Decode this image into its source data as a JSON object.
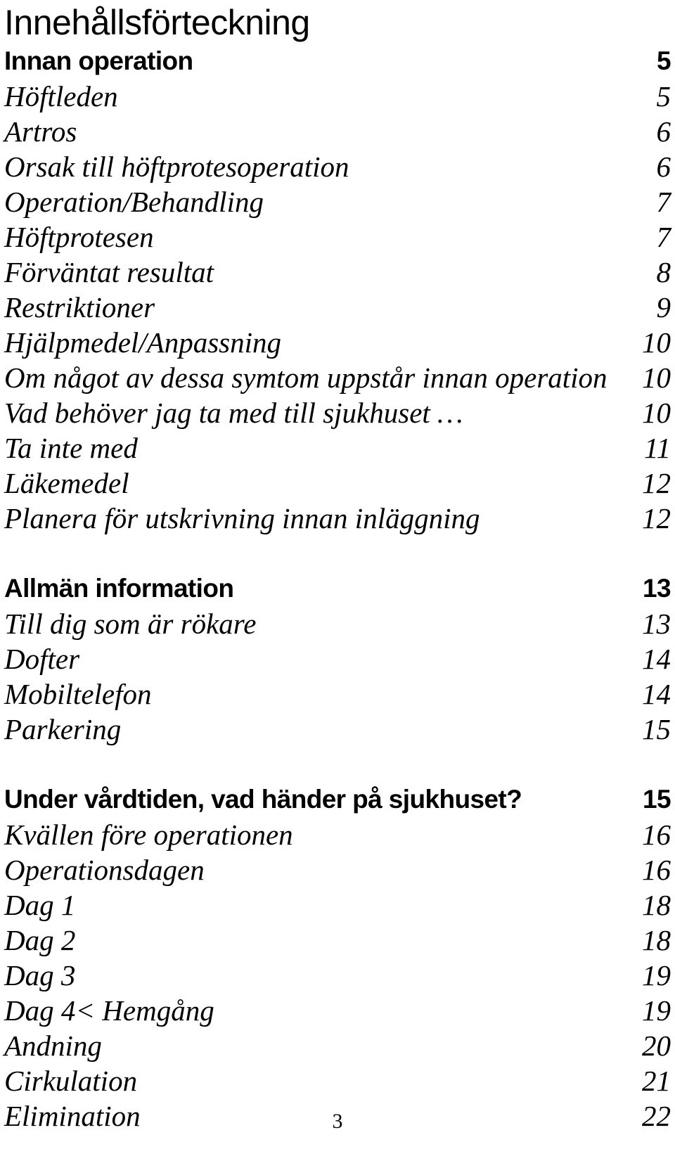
{
  "document": {
    "title": "Innehållsförteckning",
    "folio": "3"
  },
  "toc": {
    "groups": [
      {
        "id": "innan-operation",
        "heading": {
          "label": "Innan operation",
          "page": "5"
        },
        "entries": [
          {
            "label": "Höftleden",
            "page": "5"
          },
          {
            "label": "Artros",
            "page": "6"
          },
          {
            "label": "Orsak till höftprotesoperation",
            "page": "6"
          },
          {
            "label": "Operation/Behandling",
            "page": "7"
          },
          {
            "label": "Höftprotesen",
            "page": "7"
          },
          {
            "label": "Förväntat resultat",
            "page": "8"
          },
          {
            "label": "Restriktioner",
            "page": "9"
          },
          {
            "label": "Hjälpmedel/Anpassning",
            "page": "10"
          },
          {
            "label": "Om något av dessa symtom uppstår innan operation",
            "page": "10"
          },
          {
            "label": "Vad behöver jag ta med till sjukhuset …",
            "page": "10"
          },
          {
            "label": "Ta inte med",
            "page": "11"
          },
          {
            "label": "Läkemedel",
            "page": "12"
          },
          {
            "label": "Planera för utskrivning innan inläggning",
            "page": "12"
          }
        ]
      },
      {
        "id": "allman-information",
        "heading": {
          "label": "Allmän information",
          "page": "13"
        },
        "entries": [
          {
            "label": "Till dig som är rökare",
            "page": "13"
          },
          {
            "label": "Dofter",
            "page": "14"
          },
          {
            "label": "Mobiltelefon",
            "page": "14"
          },
          {
            "label": "Parkering",
            "page": "15"
          }
        ]
      },
      {
        "id": "under-vardtiden",
        "heading": {
          "label": "Under vårdtiden, vad händer på sjukhuset?",
          "page": "15"
        },
        "entries": [
          {
            "label": "Kvällen före operationen",
            "page": "16"
          },
          {
            "label": "Operationsdagen",
            "page": "16"
          },
          {
            "label": "Dag 1",
            "page": "18"
          },
          {
            "label": "Dag 2",
            "page": "18"
          },
          {
            "label": "Dag 3",
            "page": "19"
          },
          {
            "label": "Dag 4< Hemgång",
            "page": "19"
          },
          {
            "label": "Andning",
            "page": "20"
          },
          {
            "label": "Cirkulation",
            "page": "21"
          },
          {
            "label": "Elimination",
            "page": "22"
          }
        ]
      }
    ]
  }
}
